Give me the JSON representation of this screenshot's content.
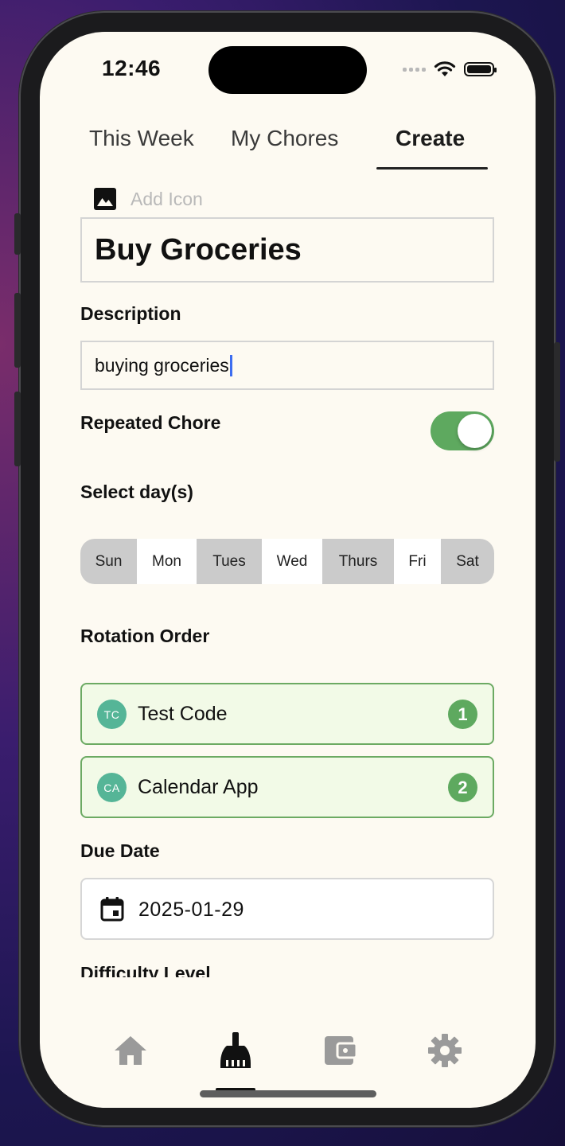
{
  "status_bar": {
    "time": "12:46"
  },
  "tabs": [
    {
      "label": "This Week"
    },
    {
      "label": "My Chores"
    },
    {
      "label": "Create"
    }
  ],
  "form": {
    "add_icon_label": "Add Icon",
    "title_value": "Buy Groceries",
    "description_label": "Description",
    "description_value": "buying groceries",
    "repeated_label": "Repeated Chore",
    "repeated_on": true,
    "select_days_label": "Select day(s)",
    "days": [
      {
        "label": "Sun",
        "selected": true
      },
      {
        "label": "Mon",
        "selected": false
      },
      {
        "label": "Tues",
        "selected": true
      },
      {
        "label": "Wed",
        "selected": false
      },
      {
        "label": "Thurs",
        "selected": true
      },
      {
        "label": "Fri",
        "selected": false
      },
      {
        "label": "Sat",
        "selected": true
      }
    ],
    "rotation_label": "Rotation Order",
    "rotation": [
      {
        "initials": "TC",
        "name": "Test Code",
        "order": "1"
      },
      {
        "initials": "CA",
        "name": "Calendar App",
        "order": "2"
      }
    ],
    "due_date_label": "Due Date",
    "due_date_value": "2025-01-29",
    "difficulty_label": "Difficulty Level"
  },
  "bottom_nav": [
    {
      "icon": "home-icon"
    },
    {
      "icon": "broom-icon",
      "active": true
    },
    {
      "icon": "wallet-icon"
    },
    {
      "icon": "gear-icon"
    }
  ],
  "colors": {
    "background": "#fdfaf2",
    "accent_green": "#5ea95f",
    "avatar_teal": "#55b597",
    "rotation_card_bg": "#f2fae7",
    "day_selected": "#cbcbcb"
  }
}
